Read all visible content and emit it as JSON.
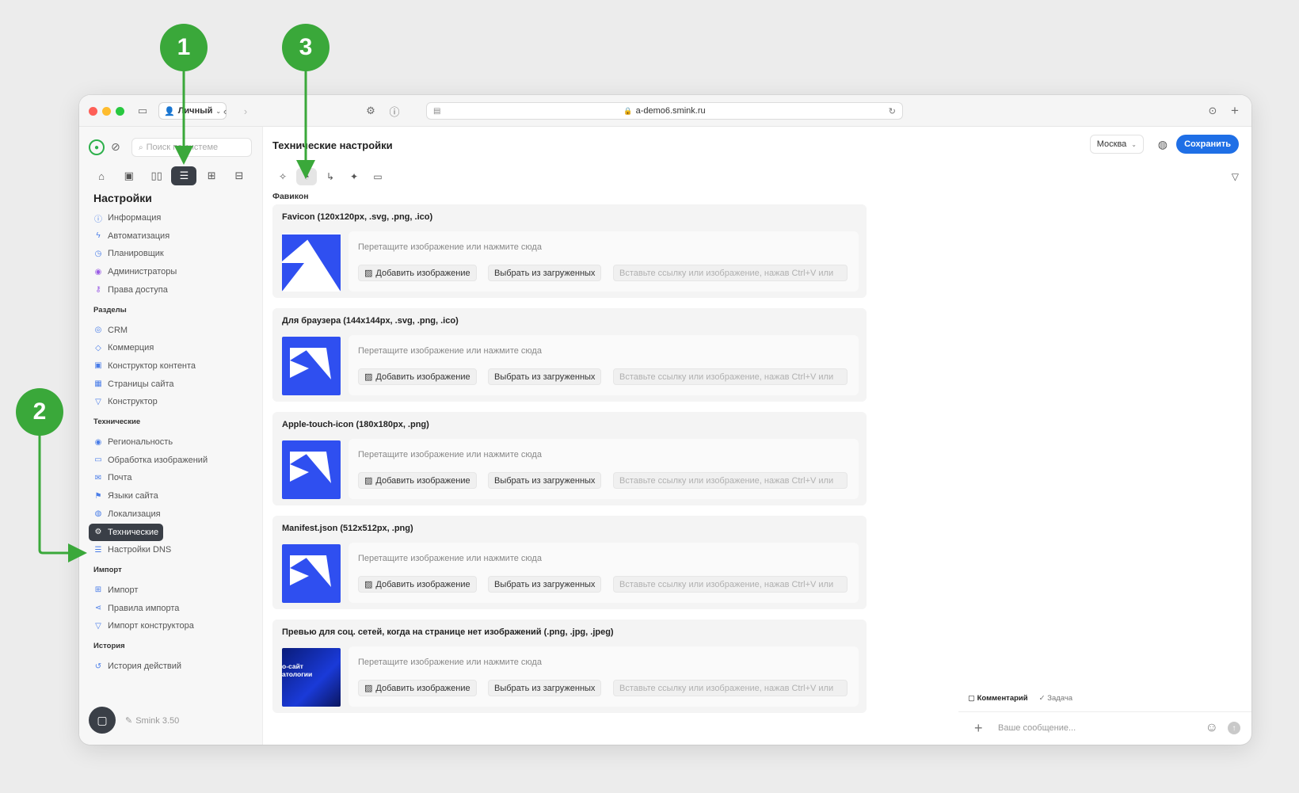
{
  "browser": {
    "profile_label": "Личный",
    "url": "a-demo6.smink.ru"
  },
  "sidebar": {
    "search_placeholder": "Поиск по системе",
    "section_title": "Настройки",
    "settings_items": [
      {
        "label": "Информация",
        "icon": "info-icon",
        "color": "#4a7de8"
      },
      {
        "label": "Автоматизация",
        "icon": "bolt-icon",
        "color": "#4a7de8"
      },
      {
        "label": "Планировщик",
        "icon": "clock-icon",
        "color": "#4a7de8"
      },
      {
        "label": "Администраторы",
        "icon": "admin-icon",
        "color": "#9b5de5"
      },
      {
        "label": "Права доступа",
        "icon": "key-icon",
        "color": "#9b5de5"
      }
    ],
    "groups": [
      {
        "title": "Разделы",
        "items": [
          {
            "label": "CRM",
            "icon": "crm-icon",
            "color": "#4a7de8"
          },
          {
            "label": "Коммерция",
            "icon": "bag-icon",
            "color": "#4a7de8"
          },
          {
            "label": "Конструктор контента",
            "icon": "content-icon",
            "color": "#4a7de8"
          },
          {
            "label": "Страницы сайта",
            "icon": "grid-icon",
            "color": "#4a7de8"
          },
          {
            "label": "Конструктор",
            "icon": "builder-icon",
            "color": "#4a7de8"
          }
        ]
      },
      {
        "title": "Технические",
        "items": [
          {
            "label": "Региональность",
            "icon": "region-icon",
            "color": "#4a7de8"
          },
          {
            "label": "Обработка изображений",
            "icon": "image-icon",
            "color": "#4a7de8"
          },
          {
            "label": "Почта",
            "icon": "mail-icon",
            "color": "#4a7de8"
          },
          {
            "label": "Языки сайта",
            "icon": "flag-icon",
            "color": "#4a7de8"
          },
          {
            "label": "Локализация",
            "icon": "globe-icon",
            "color": "#4a7de8"
          },
          {
            "label": "Технические",
            "icon": "gear-icon",
            "color": "#ffffff",
            "active": true
          },
          {
            "label": "Настройки DNS",
            "icon": "dns-icon",
            "color": "#4a7de8"
          }
        ]
      },
      {
        "title": "Импорт",
        "items": [
          {
            "label": "Импорт",
            "icon": "import-icon",
            "color": "#4a7de8"
          },
          {
            "label": "Правила импорта",
            "icon": "rules-icon",
            "color": "#4a7de8"
          },
          {
            "label": "Импорт конструктора",
            "icon": "import-builder-icon",
            "color": "#4a7de8"
          }
        ]
      },
      {
        "title": "История",
        "items": [
          {
            "label": "История действий",
            "icon": "history-icon",
            "color": "#4a7de8"
          }
        ]
      }
    ],
    "version": "Smink 3.50"
  },
  "header": {
    "title": "Технические настройки",
    "city": "Москва",
    "save_label": "Сохранить"
  },
  "content": {
    "subsection_title": "Фавикон",
    "cards": [
      {
        "title": "Favicon (120x120px, .svg, .png, .ico)",
        "thumb": "logo-white"
      },
      {
        "title": "Для браузера (144x144px, .svg, .png, .ico)",
        "thumb": "logo-blue"
      },
      {
        "title": "Apple-touch-icon (180x180px, .png)",
        "thumb": "logo-blue"
      },
      {
        "title": "Manifest.json (512x512px, .png)",
        "thumb": "logo-blue"
      },
      {
        "title": "Превью для соц. сетей, когда на странице нет изображений (.png, .jpg, .jpeg)",
        "thumb": "preview",
        "thumb_text": "о-сайт\nатологии"
      }
    ],
    "drop_hint": "Перетащите изображение или нажмите сюда",
    "add_image_label": "Добавить изображение",
    "choose_uploaded_label": "Выбрать из загруженных",
    "url_placeholder": "Вставьте ссылку или изображение, нажав Ctrl+V или"
  },
  "comments": {
    "tab_comment": "Комментарий",
    "tab_task": "Задача",
    "message_placeholder": "Ваше сообщение..."
  },
  "annotations": {
    "marker_1": "1",
    "marker_2": "2",
    "marker_3": "3",
    "color": "#3aa83a"
  }
}
